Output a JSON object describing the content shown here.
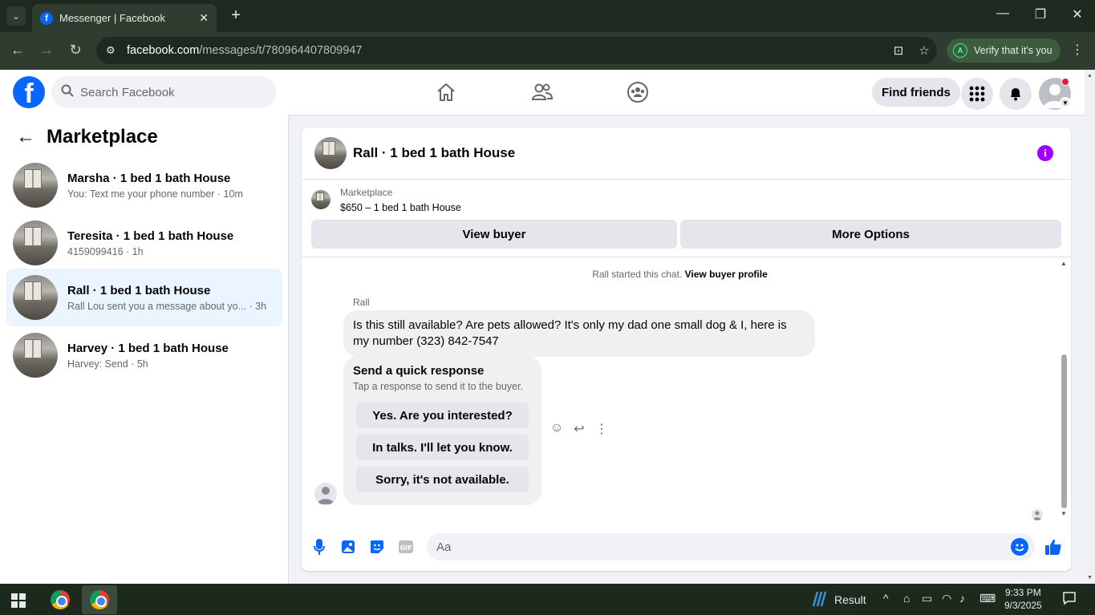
{
  "browser": {
    "tab_title": "Messenger | Facebook",
    "url_host": "facebook.com",
    "url_path": "/messages/t/780964407809947",
    "verify_label": "Verify that it's you",
    "verify_avatar": "A"
  },
  "fb": {
    "search_placeholder": "Search Facebook",
    "find_friends": "Find friends"
  },
  "sidebar": {
    "title": "Marketplace",
    "conversations": [
      {
        "name": "Marsha · 1 bed 1 bath House",
        "preview": "You: Text me your phone number · 10m",
        "active": false
      },
      {
        "name": "Teresita · 1 bed 1 bath House",
        "preview": "4159099416 · 1h",
        "active": false
      },
      {
        "name": "Rall · 1 bed 1 bath House",
        "preview": "Rall Lou sent you a message about yo... · 3h",
        "active": true
      },
      {
        "name": "Harvey · 1 bed 1 bath House",
        "preview": "Harvey: Send · 5h",
        "active": false
      }
    ]
  },
  "chat": {
    "title": "Rall · 1 bed 1 bath House",
    "listing_source": "Marketplace",
    "listing_desc": "$650 – 1 bed 1 bath House",
    "view_buyer": "View buyer",
    "more_options": "More Options",
    "started_text": "Rall started this chat.",
    "view_buyer_profile": "View buyer profile",
    "sender": "Rall",
    "message": "Is this still available? Are pets allowed? It's only my dad one small dog & I, here is my number (323) 842-7547",
    "quick_title": "Send a quick response",
    "quick_sub": "Tap a response to send it to the buyer.",
    "quick_options": [
      "Yes. Are you interested?",
      "In talks. I'll let you know.",
      "Sorry, it's not available."
    ],
    "composer_placeholder": "Aa"
  },
  "taskbar": {
    "weather": "Result",
    "time": "9:33 PM",
    "date": "9/3/2025"
  },
  "colors": {
    "fb_blue": "#0866ff",
    "info_purple": "#a000ff",
    "active_conv": "#ebf5ff"
  }
}
